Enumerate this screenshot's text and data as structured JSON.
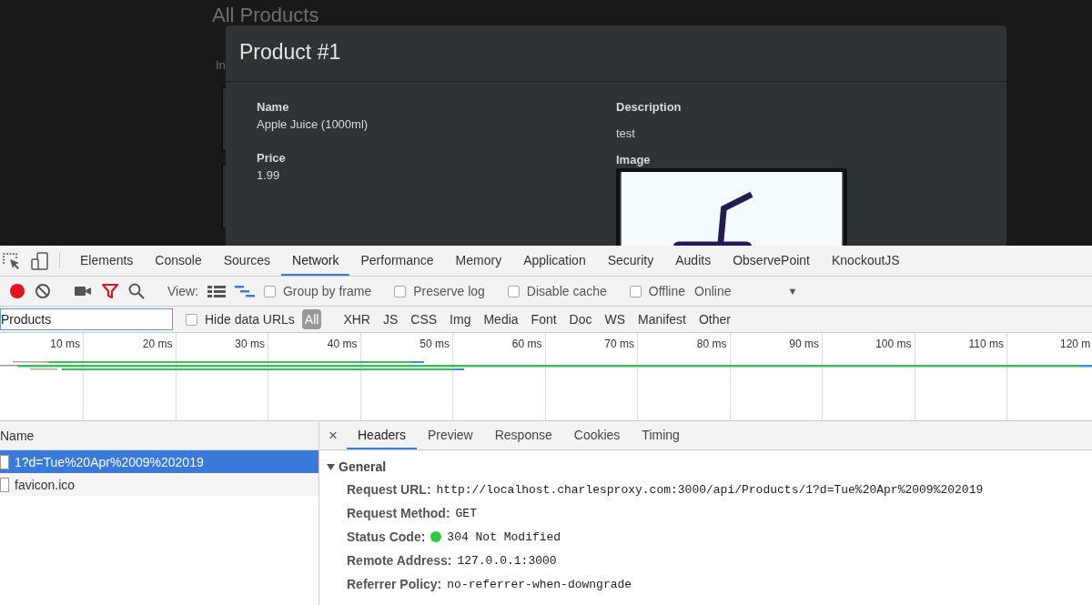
{
  "page": {
    "heading": "All Products",
    "behind_text": "In"
  },
  "modal": {
    "title": "Product #1",
    "columns": [
      {
        "fields": [
          {
            "label": "Name",
            "value": "Apple Juice (1000ml)"
          },
          {
            "label": "Price",
            "value": "1.99"
          }
        ]
      },
      {
        "fields": [
          {
            "label": "Description",
            "value": "test"
          },
          {
            "label": "Image",
            "kind": "picture"
          }
        ]
      }
    ]
  },
  "devtools": {
    "tabs": [
      {
        "label": "Elements",
        "selected": false
      },
      {
        "label": "Console",
        "selected": false
      },
      {
        "label": "Sources",
        "selected": false
      },
      {
        "label": "Network",
        "selected": true
      },
      {
        "label": "Performance",
        "selected": false
      },
      {
        "label": "Memory",
        "selected": false
      },
      {
        "label": "Application",
        "selected": false
      },
      {
        "label": "Security",
        "selected": false
      },
      {
        "label": "Audits",
        "selected": false
      },
      {
        "label": "ObservePoint",
        "selected": false
      },
      {
        "label": "KnockoutJS",
        "selected": false
      }
    ],
    "toolbar": {
      "recording": true,
      "filter_active": true,
      "view_label": "View:",
      "views": [
        {
          "kind": "list",
          "selected": false
        },
        {
          "kind": "waterfall",
          "selected": true
        }
      ],
      "checkboxes": [
        {
          "label": "Group by frame",
          "checked": false
        },
        {
          "label": "Preserve log",
          "checked": false
        },
        {
          "label": "Disable cache",
          "checked": false
        },
        {
          "label": "Offline",
          "checked": false
        }
      ],
      "throttle": {
        "value": "Online",
        "arrow": "▼"
      }
    },
    "filter": {
      "value": "Products",
      "hide_data_urls": {
        "label": "Hide data URLs",
        "checked": false
      },
      "types": [
        {
          "label": "All",
          "selected": true
        },
        {
          "label": "XHR",
          "selected": false
        },
        {
          "label": "JS",
          "selected": false
        },
        {
          "label": "CSS",
          "selected": false
        },
        {
          "label": "Img",
          "selected": false
        },
        {
          "label": "Media",
          "selected": false
        },
        {
          "label": "Font",
          "selected": false
        },
        {
          "label": "Doc",
          "selected": false
        },
        {
          "label": "WS",
          "selected": false
        },
        {
          "label": "Manifest",
          "selected": false
        },
        {
          "label": "Other",
          "selected": false
        }
      ]
    },
    "timeline": {
      "ticks": [
        "10 ms",
        "20 ms",
        "30 ms",
        "40 ms",
        "50 ms",
        "60 ms",
        "70 ms",
        "80 ms",
        "90 ms",
        "100 ms",
        "110 ms",
        "120 m"
      ]
    },
    "requests": {
      "column": "Name",
      "rows": [
        {
          "name": "1?d=Tue%20Apr%2009%202019",
          "selected": true
        },
        {
          "name": "favicon.ico",
          "selected": false
        }
      ]
    },
    "details": {
      "close": "×",
      "tabs": [
        {
          "label": "Headers",
          "selected": true
        },
        {
          "label": "Preview",
          "selected": false
        },
        {
          "label": "Response",
          "selected": false
        },
        {
          "label": "Cookies",
          "selected": false
        },
        {
          "label": "Timing",
          "selected": false
        }
      ],
      "section": {
        "title": "General",
        "expanded": true,
        "rows": [
          {
            "key": "Request URL:",
            "value": "http://localhost.charlesproxy.com:3000/api/Products/1?d=Tue%20Apr%2009%202019"
          },
          {
            "key": "Request Method:",
            "value": "GET"
          },
          {
            "key": "Status Code:",
            "value": "304 Not Modified",
            "color": "#2ecc40"
          },
          {
            "key": "Remote Address:",
            "value": "127.0.0.1:3000"
          },
          {
            "key": "Referrer Policy:",
            "value": "no-referrer-when-downgrade"
          }
        ]
      }
    }
  }
}
